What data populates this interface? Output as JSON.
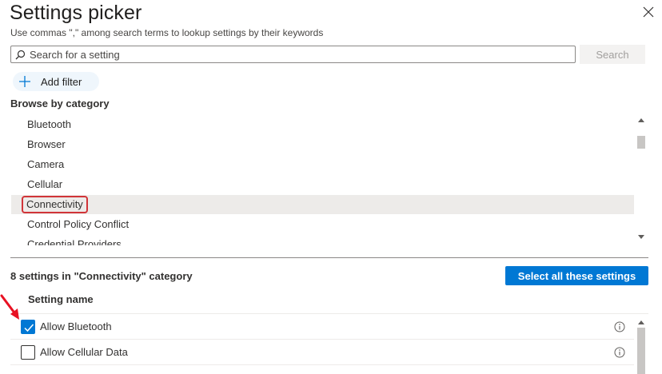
{
  "header": {
    "title": "Settings picker",
    "subtitle": "Use commas \",\" among search terms to lookup settings by their keywords"
  },
  "search": {
    "placeholder": "Search for a setting",
    "button_label": "Search"
  },
  "filter": {
    "add_label": "Add filter"
  },
  "browse": {
    "label": "Browse by category",
    "categories": [
      {
        "label": "Bluetooth"
      },
      {
        "label": "Browser"
      },
      {
        "label": "Camera"
      },
      {
        "label": "Cellular"
      },
      {
        "label": "Connectivity",
        "selected": true
      },
      {
        "label": "Control Policy Conflict"
      },
      {
        "label": "Credential Providers"
      }
    ]
  },
  "settings": {
    "count_label": "8 settings in \"Connectivity\" category",
    "select_all_label": "Select all these settings",
    "column_header": "Setting name",
    "rows": [
      {
        "label": "Allow Bluetooth",
        "checked": true
      },
      {
        "label": "Allow Cellular Data",
        "checked": false
      }
    ]
  },
  "icons": {
    "close": "close-icon",
    "search": "search-icon",
    "add": "plus-icon",
    "info": "info-icon",
    "annotation": "red-arrow-icon"
  },
  "colors": {
    "accent": "#0078d4",
    "highlight": "#d13438",
    "selected_bg": "#edebe9"
  }
}
